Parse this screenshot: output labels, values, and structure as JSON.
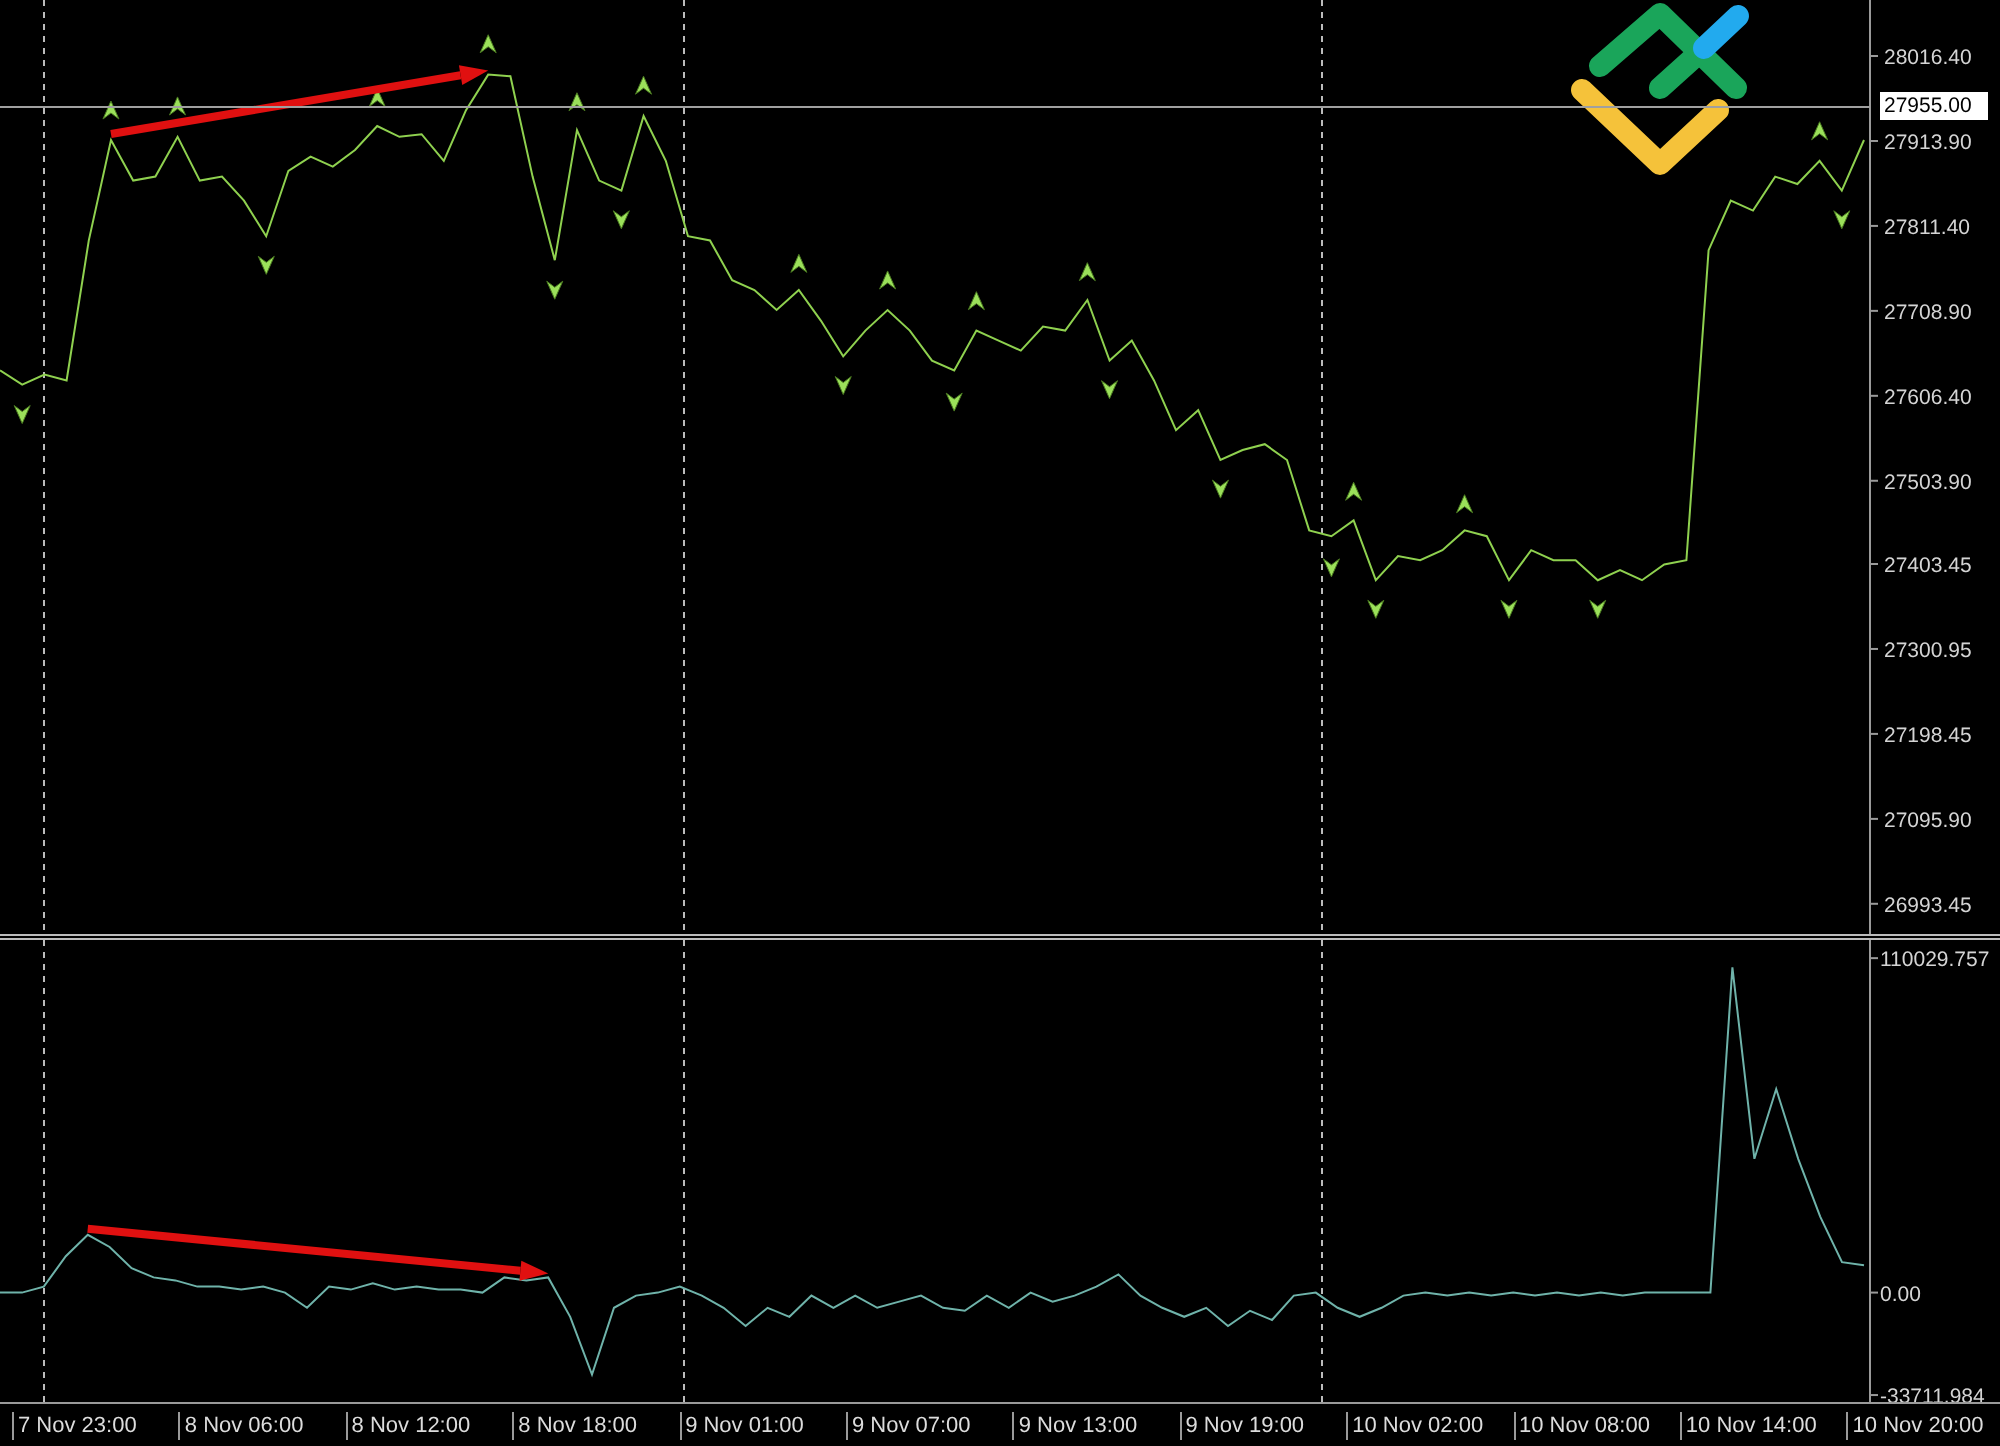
{
  "price_chart": {
    "current_price": "27955.00",
    "chart_data": {
      "type": "line",
      "ylim": [
        26957,
        28084
      ],
      "yticks": [
        {
          "value": 28016.4,
          "label": "28016.40"
        },
        {
          "value": 27913.9,
          "label": "27913.90"
        },
        {
          "value": 27811.4,
          "label": "27811.40"
        },
        {
          "value": 27708.9,
          "label": "27708.90"
        },
        {
          "value": 27606.4,
          "label": "27606.40"
        },
        {
          "value": 27503.9,
          "label": "27503.90"
        },
        {
          "value": 27403.45,
          "label": "27403.45"
        },
        {
          "value": 27300.95,
          "label": "27300.95"
        },
        {
          "value": 27198.45,
          "label": "27198.45"
        },
        {
          "value": 27095.9,
          "label": "27095.90"
        },
        {
          "value": 26993.45,
          "label": "26993.45"
        }
      ],
      "series": [
        {
          "color": "#8fd14f",
          "values": [
            27637,
            27620,
            27632,
            27625,
            27794,
            27915,
            27866,
            27871,
            27919,
            27866,
            27871,
            27842,
            27799,
            27878,
            27895,
            27883,
            27903,
            27932,
            27919,
            27922,
            27890,
            27951,
            27994,
            27992,
            27871,
            27770,
            27927,
            27866,
            27854,
            27944,
            27890,
            27799,
            27794,
            27746,
            27734,
            27710,
            27734,
            27697,
            27654,
            27685,
            27710,
            27685,
            27649,
            27637,
            27685,
            27673,
            27661,
            27690,
            27685,
            27722,
            27649,
            27673,
            27625,
            27565,
            27589,
            27529,
            27541,
            27548,
            27529,
            27444,
            27437,
            27456,
            27384,
            27413,
            27408,
            27420,
            27444,
            27437,
            27384,
            27420,
            27408,
            27408,
            27384,
            27396,
            27384,
            27403,
            27408,
            27782,
            27842,
            27830,
            27871,
            27862,
            27890,
            27854,
            27915
          ]
        },
        {
          "type": "scatter",
          "color": "#9be05a",
          "values": [
            null,
            27585,
            null,
            null,
            null,
            27950,
            null,
            null,
            27955,
            null,
            null,
            null,
            27765,
            null,
            null,
            null,
            null,
            27965,
            null,
            null,
            null,
            null,
            28030,
            null,
            null,
            27735,
            27960,
            null,
            27820,
            27980,
            null,
            null,
            null,
            null,
            null,
            null,
            27765,
            null,
            27620,
            null,
            27745,
            null,
            null,
            27600,
            27720,
            null,
            null,
            null,
            null,
            27755,
            27615,
            null,
            null,
            null,
            null,
            27495,
            null,
            null,
            null,
            null,
            27400,
            27490,
            27350,
            null,
            null,
            null,
            27475,
            null,
            27350,
            null,
            null,
            null,
            27350,
            null,
            null,
            null,
            null,
            null,
            null,
            null,
            null,
            null,
            27925,
            27820,
            null
          ]
        }
      ]
    }
  },
  "indicator_chart": {
    "chart_data": {
      "type": "line",
      "ylim": [
        -36000,
        116000
      ],
      "yticks": [
        {
          "value": 110029.757,
          "label": "110029.757"
        },
        {
          "value": 0,
          "label": "0.00"
        },
        {
          "value": -33711.984,
          "label": "-33711.984"
        }
      ],
      "series": [
        {
          "color": "#6fb3aa",
          "values": [
            0,
            0,
            2000,
            12000,
            19000,
            15000,
            8000,
            5000,
            4000,
            2000,
            2000,
            1000,
            2000,
            0,
            -5000,
            2000,
            1000,
            3000,
            1000,
            2000,
            1000,
            1000,
            0,
            5000,
            4000,
            5000,
            -8000,
            -27000,
            -5000,
            -1000,
            0,
            2000,
            -1000,
            -5000,
            -11000,
            -5000,
            -8000,
            -1000,
            -5000,
            -1000,
            -5000,
            -3000,
            -1000,
            -5000,
            -6000,
            -1000,
            -5000,
            0,
            -3000,
            -1000,
            2000,
            6000,
            -1000,
            -5000,
            -8000,
            -5000,
            -11000,
            -6000,
            -9000,
            -1000,
            0,
            -5000,
            -8000,
            -5000,
            -1000,
            0,
            -1000,
            0,
            -1000,
            0,
            -1000,
            0,
            -1000,
            0,
            -1000,
            0,
            0,
            0,
            0,
            107000,
            44000,
            67000,
            44000,
            25000,
            10000,
            9000
          ]
        }
      ]
    }
  },
  "time_axis": [
    "7 Nov 23:00",
    "8 Nov 06:00",
    "8 Nov 12:00",
    "8 Nov 18:00",
    "9 Nov 01:00",
    "9 Nov 07:00",
    "9 Nov 13:00",
    "9 Nov 19:00",
    "10 Nov 02:00",
    "10 Nov 08:00",
    "10 Nov 14:00",
    "10 Nov 20:00"
  ]
}
